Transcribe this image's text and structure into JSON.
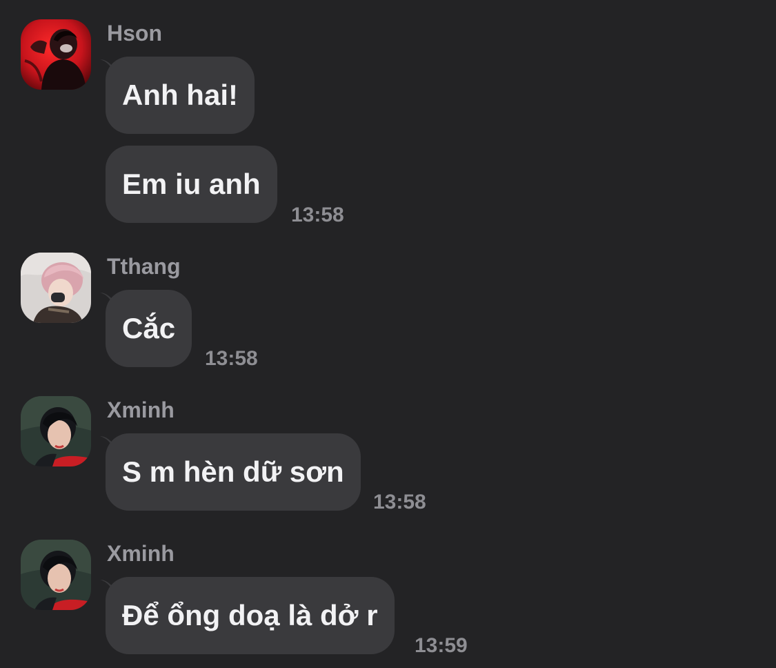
{
  "messages": [
    {
      "sender": "Hson",
      "avatar": "avatar-hson",
      "bubbles": [
        "Anh hai!",
        "Em iu anh"
      ],
      "time": "13:58"
    },
    {
      "sender": "Tthang",
      "avatar": "avatar-tthang",
      "bubbles": [
        "Cắc"
      ],
      "time": "13:58"
    },
    {
      "sender": "Xminh",
      "avatar": "avatar-xminh",
      "bubbles": [
        "S m hèn dữ sơn"
      ],
      "time": "13:58"
    },
    {
      "sender": "Xminh",
      "avatar": "avatar-xminh",
      "bubbles": [
        "Để ổng doạ là dở r"
      ],
      "time": "13:59"
    }
  ],
  "colors": {
    "background": "#232325",
    "bubble": "#3a3a3d",
    "bubble_text": "#f2f2f4",
    "sender_text": "#9a9aa0",
    "time_text": "#8e8e93"
  }
}
